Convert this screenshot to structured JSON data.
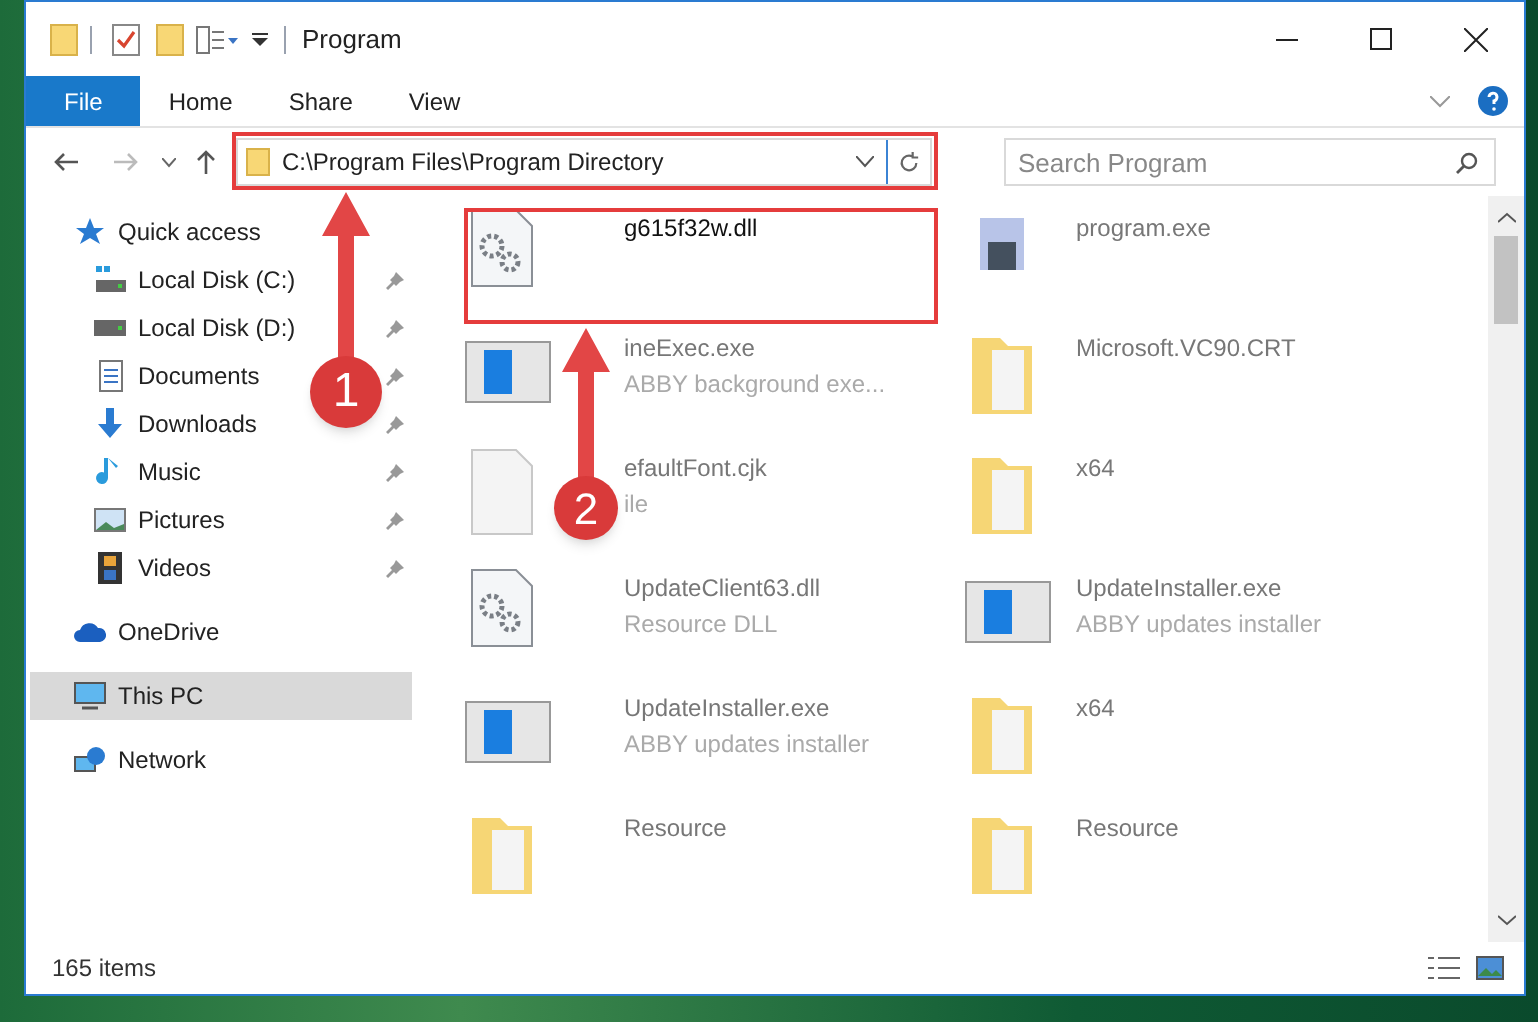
{
  "window": {
    "title": "Program"
  },
  "ribbon_tabs": [
    {
      "label": "File",
      "selected": true
    },
    {
      "label": "Home",
      "selected": false
    },
    {
      "label": "Share",
      "selected": false
    },
    {
      "label": "View",
      "selected": false
    }
  ],
  "address": {
    "path": "C:\\Program Files\\Program Directory"
  },
  "search": {
    "placeholder": "Search Program"
  },
  "sidebar": {
    "items": [
      {
        "label": "Quick access",
        "kind": "star",
        "selected": false,
        "children": [
          {
            "label": "Local Disk (C:)",
            "kind": "windrive",
            "pinned": true
          },
          {
            "label": "Local Disk (D:)",
            "kind": "drive",
            "pinned": true
          },
          {
            "label": "Documents",
            "kind": "documents",
            "pinned": true
          },
          {
            "label": "Downloads",
            "kind": "downloads",
            "pinned": true
          },
          {
            "label": "Music",
            "kind": "music",
            "pinned": true
          },
          {
            "label": "Pictures",
            "kind": "pictures",
            "pinned": true
          },
          {
            "label": "Videos",
            "kind": "videos",
            "pinned": true
          }
        ]
      },
      {
        "label": "OneDrive",
        "kind": "cloud",
        "selected": false
      },
      {
        "label": "This PC",
        "kind": "pc",
        "selected": true
      },
      {
        "label": "Network",
        "kind": "network",
        "selected": false
      }
    ]
  },
  "files": [
    {
      "name": "g615f32w.dll",
      "kind": "dll",
      "blurred": false
    },
    {
      "name": "program.exe",
      "kind": "app",
      "blurred": true
    },
    {
      "name": "ineExec.exe",
      "description": "ABBY background exe...",
      "kind": "window",
      "blurred": true
    },
    {
      "name": "Microsoft.VC90.CRT",
      "kind": "folder",
      "blurred": true
    },
    {
      "name": "efaultFont.cjk",
      "description": "ile",
      "kind": "blank",
      "blurred": true
    },
    {
      "name": "x64",
      "kind": "folder",
      "blurred": true
    },
    {
      "name": "UpdateClient63.dll",
      "description": "Resource DLL",
      "kind": "dll",
      "blurred": true
    },
    {
      "name": "UpdateInstaller.exe",
      "description": "ABBY updates installer",
      "kind": "window",
      "blurred": true
    },
    {
      "name": "UpdateInstaller.exe",
      "description": "ABBY updates installer",
      "kind": "window",
      "blurred": true
    },
    {
      "name": "x64",
      "kind": "folder",
      "blurred": true
    },
    {
      "name": "Resource",
      "kind": "folder",
      "blurred": true
    },
    {
      "name": "Resource",
      "kind": "folder",
      "blurred": true
    }
  ],
  "status_bar": {
    "count": "165 items"
  },
  "annotations": [
    {
      "label": "1"
    },
    {
      "label": "2"
    }
  ]
}
